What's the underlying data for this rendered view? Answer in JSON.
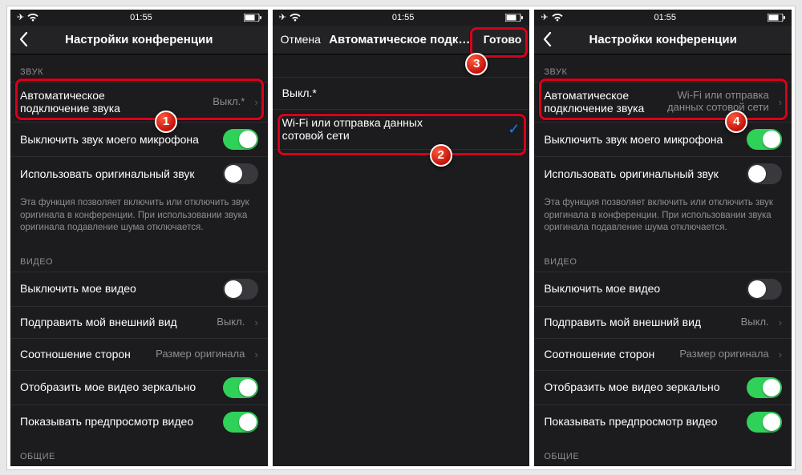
{
  "status": {
    "time": "01:55"
  },
  "screens": {
    "a": {
      "nav": {
        "title": "Настройки конференции"
      },
      "sections": {
        "sound_header": "ЗВУК",
        "auto_audio_label_l1": "Автоматическое",
        "auto_audio_label_l2": "подключение звука",
        "auto_audio_value": "Выкл.*",
        "mute_mic_label": "Выключить звук моего микрофона",
        "orig_sound_label": "Использовать оригинальный звук",
        "orig_sound_note": "Эта функция позволяет включить или отключить звук оригинала в конференции. При использовании звука оригинала подавление шума отключается.",
        "video_header": "ВИДЕО",
        "mute_video_label": "Выключить мое видео",
        "touchup_label": "Подправить мой внешний вид",
        "touchup_value": "Выкл.",
        "aspect_label": "Соотношение сторон",
        "aspect_value": "Размер оригинала",
        "mirror_label": "Отобразить мое видео зеркально",
        "preview_label": "Показывать предпросмотр видео",
        "general_header": "ОБЩИЕ"
      }
    },
    "b": {
      "nav": {
        "cancel": "Отмена",
        "title": "Автоматическое подкл…",
        "done": "Готово"
      },
      "opt_off": "Выкл.*",
      "opt_wifi_l1": "Wi-Fi или отправка данных",
      "opt_wifi_l2": "сотовой сети"
    },
    "c": {
      "nav": {
        "title": "Настройки конференции"
      },
      "sections": {
        "sound_header": "ЗВУК",
        "auto_audio_label_l1": "Автоматическое",
        "auto_audio_label_l2": "подключение звука",
        "auto_audio_value_l1": "Wi-Fi или отправка",
        "auto_audio_value_l2": "данных сотовой сети",
        "mute_mic_label": "Выключить звук моего микрофона",
        "orig_sound_label": "Использовать оригинальный звук",
        "orig_sound_note": "Эта функция позволяет включить или отключить звук оригинала в конференции. При использовании звука оригинала подавление шума отключается.",
        "video_header": "ВИДЕО",
        "mute_video_label": "Выключить мое видео",
        "touchup_label": "Подправить мой внешний вид",
        "touchup_value": "Выкл.",
        "aspect_label": "Соотношение сторон",
        "aspect_value": "Размер оригинала",
        "mirror_label": "Отобразить мое видео зеркально",
        "preview_label": "Показывать предпросмотр видео",
        "general_header": "ОБЩИЕ"
      }
    }
  },
  "badges": {
    "b1": "1",
    "b2": "2",
    "b3": "3",
    "b4": "4"
  }
}
